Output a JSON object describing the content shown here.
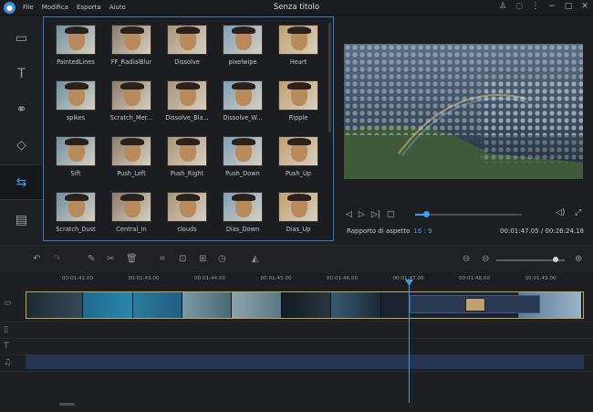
{
  "app": {
    "title": "Senza titolo",
    "menu": [
      "File",
      "Modifica",
      "Esporta",
      "Aiuto"
    ],
    "window_icons": [
      "user-icon",
      "chat-icon",
      "more-icon",
      "minimize-icon",
      "maximize-icon",
      "close-icon"
    ]
  },
  "sidebar": {
    "items": [
      {
        "icon": "media-icon",
        "active": false
      },
      {
        "icon": "text-icon",
        "active": false
      },
      {
        "icon": "filters-icon",
        "active": false
      },
      {
        "icon": "overlays-icon",
        "active": false
      },
      {
        "icon": "transitions-icon",
        "active": true
      },
      {
        "icon": "film-icon",
        "active": false
      }
    ]
  },
  "transitions": [
    {
      "label": "PaintedLines"
    },
    {
      "label": "FF_RadialBlur"
    },
    {
      "label": "Dissolve"
    },
    {
      "label": "pixelwipe"
    },
    {
      "label": "Heart"
    },
    {
      "label": "spikes"
    },
    {
      "label": "Scratch_Mer..."
    },
    {
      "label": "Dissolve_Bla..."
    },
    {
      "label": "Dissolve_W..."
    },
    {
      "label": "Ripple"
    },
    {
      "label": "Sift"
    },
    {
      "label": "Push_Left"
    },
    {
      "label": "Push_Right"
    },
    {
      "label": "Push_Down"
    },
    {
      "label": "Push_Up"
    },
    {
      "label": "Scratch_Dust"
    },
    {
      "label": "Central_In"
    },
    {
      "label": "clouds"
    },
    {
      "label": "Dias_Down"
    },
    {
      "label": "Dias_Up"
    }
  ],
  "player": {
    "aspect_label": "Rapporto di aspetto",
    "aspect_value": "16 : 9",
    "time": "00:01:47.05 / 00:26:24.18",
    "progress": 0.08
  },
  "timeline": {
    "ticks": [
      "00:01:42.00",
      "00:01:43.00",
      "00:01:44.00",
      "00:01:45.00",
      "00:01:46.00",
      "00:01:47.00",
      "00:01:48.00",
      "00:01:49.00"
    ],
    "zoom": 0.85
  },
  "colors": {
    "accent": "#3a9ee8",
    "clip_border": "#c9a64a"
  }
}
